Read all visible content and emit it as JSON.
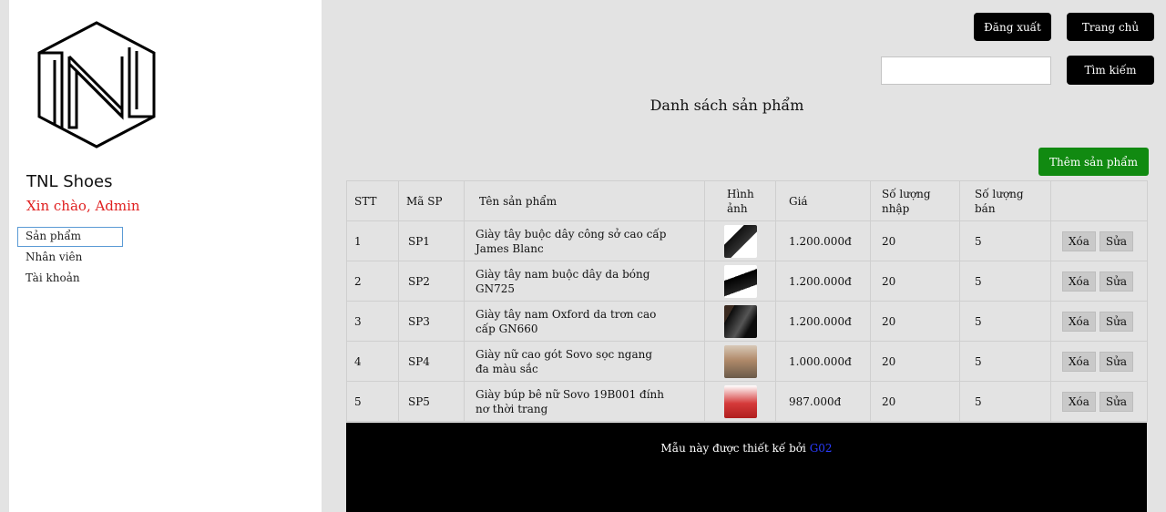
{
  "sidebar": {
    "brand": "TNL Shoes",
    "greeting": "Xin chào, Admin",
    "nav": [
      {
        "label": "Sản phẩm"
      },
      {
        "label": "Nhân viên"
      },
      {
        "label": "Tài khoản"
      }
    ]
  },
  "header": {
    "logout_label": "Đăng xuất",
    "home_label": "Trang chủ",
    "search_label": "Tìm kiếm",
    "search_value": ""
  },
  "main": {
    "title": "Danh sách sản phẩm",
    "add_label": "Thêm sản phẩm",
    "columns": [
      "STT",
      "Mã SP",
      "Tên sản phẩm",
      "Hình ảnh",
      "Giá",
      "Số lượng nhập",
      "Số lượng bán",
      ""
    ],
    "rows": [
      {
        "stt": "1",
        "code": "SP1",
        "name": "Giày tây buộc dây công sở cao cấp James Blanc",
        "image": "shoe-black-oxford",
        "price": "1.200.000đ",
        "qty_in": "20",
        "qty_sold": "5"
      },
      {
        "stt": "2",
        "code": "SP2",
        "name": "Giày tây nam buộc dây da bóng GN725",
        "image": "shoe-black-glossy",
        "price": "1.200.000đ",
        "qty_in": "20",
        "qty_sold": "5"
      },
      {
        "stt": "3",
        "code": "SP3",
        "name": "Giày tây nam Oxford da trơn cao cấp GN660",
        "image": "shoe-black-plain",
        "price": "1.200.000đ",
        "qty_in": "20",
        "qty_sold": "5"
      },
      {
        "stt": "4",
        "code": "SP4",
        "name": "Giày nữ cao gót Sovo sọc ngang đa màu sắc",
        "image": "shoe-high-heel",
        "price": "1.000.000đ",
        "qty_in": "20",
        "qty_sold": "5"
      },
      {
        "stt": "5",
        "code": "SP5",
        "name": "Giày búp bê nữ Sovo 19B001 đính nơ thời trang",
        "image": "shoe-red-flat",
        "price": "987.000đ",
        "qty_in": "20",
        "qty_sold": "5"
      }
    ],
    "delete_label": "Xóa",
    "edit_label": "Sửa"
  },
  "footer": {
    "text": "Mẫu này được thiết kế bởi",
    "link": "G02"
  }
}
